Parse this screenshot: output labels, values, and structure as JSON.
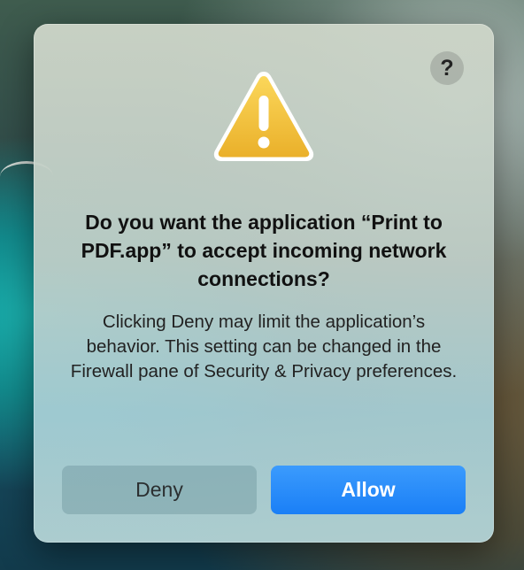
{
  "dialog": {
    "help_label": "?",
    "title": "Do you want the application “Print to PDF.app” to accept incoming network connections?",
    "message": "Clicking Deny may limit the application’s behavior. This setting can be changed in the Firewall pane of Security & Privacy preferences.",
    "deny_label": "Deny",
    "allow_label": "Allow"
  },
  "icons": {
    "warning": "warning-triangle-icon",
    "help": "question-mark-icon"
  },
  "colors": {
    "allow_button": "#1a7ff6",
    "warning_fill": "#f5c33b"
  }
}
